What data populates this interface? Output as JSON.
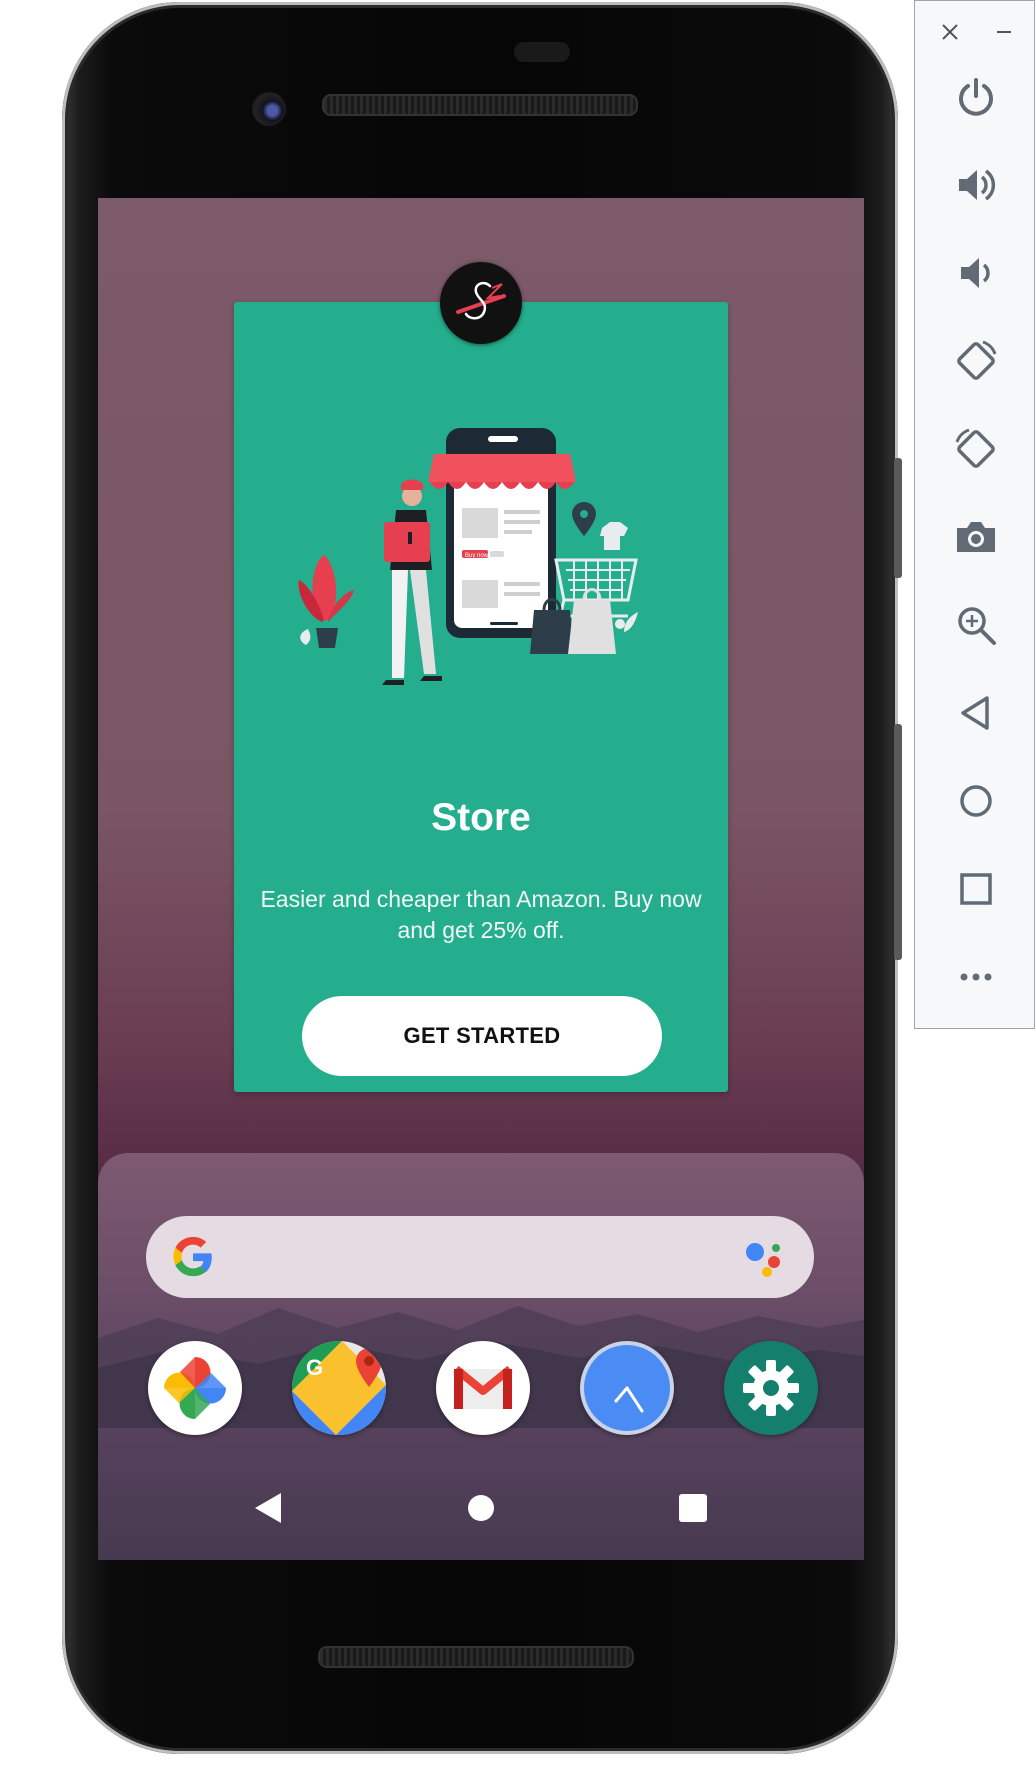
{
  "screen": {
    "card": {
      "title": "Store",
      "description": "Easier and cheaper than Amazon. Buy now and get 25% off.",
      "cta_label": "GET STARTED",
      "accent_color": "#24ae8d",
      "illustration": {
        "badge_text": "Buy now"
      }
    },
    "dock": {
      "search": {
        "left_icon": "google-g-icon",
        "right_icon": "google-assistant-icon"
      },
      "apps": [
        {
          "name": "photos-app-icon"
        },
        {
          "name": "maps-app-icon"
        },
        {
          "name": "gmail-app-icon"
        },
        {
          "name": "clock-app-icon"
        },
        {
          "name": "settings-app-icon"
        }
      ]
    },
    "navbar": [
      "back-icon",
      "home-icon",
      "recents-icon"
    ]
  },
  "emulator_panel": {
    "window_controls": [
      "close-icon",
      "minimize-icon"
    ],
    "buttons": [
      "power-icon",
      "volume-up-icon",
      "volume-down-icon",
      "rotate-left-icon",
      "rotate-right-icon",
      "screenshot-camera-icon",
      "zoom-icon",
      "back-icon",
      "home-icon",
      "overview-icon",
      "more-icon"
    ]
  }
}
